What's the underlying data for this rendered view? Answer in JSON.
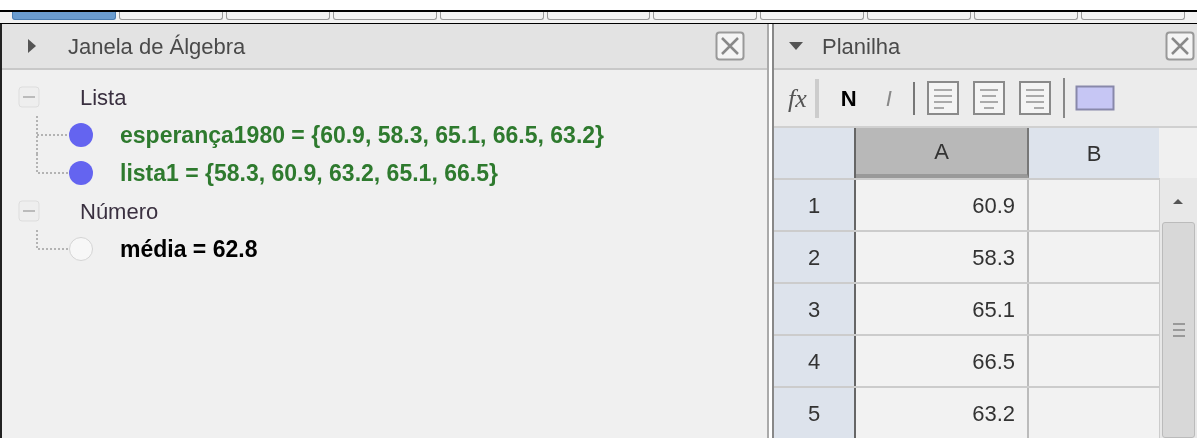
{
  "tabs": [
    {
      "selected": true
    },
    {
      "selected": false
    },
    {
      "selected": false
    },
    {
      "selected": false
    },
    {
      "selected": false
    },
    {
      "selected": false
    },
    {
      "selected": false
    },
    {
      "selected": false
    },
    {
      "selected": false
    },
    {
      "selected": false
    },
    {
      "selected": false
    }
  ],
  "algebra": {
    "title": "Janela de Álgebra",
    "expanded": false,
    "groups": [
      {
        "label": "Lista",
        "expanded": true,
        "children": [
          {
            "text": "esperança1980 = {60.9, 58.3, 65.1, 66.5, 63.2}",
            "visible": true,
            "color": "#2e7a2e"
          },
          {
            "text": "lista1 = {58.3, 60.9, 63.2, 65.1, 66.5}",
            "visible": true,
            "color": "#2e7a2e"
          }
        ]
      },
      {
        "label": "Número",
        "expanded": true,
        "children": [
          {
            "text": "média = 62.8",
            "visible": false,
            "color": "#000000"
          }
        ]
      }
    ]
  },
  "spreadsheet": {
    "title": "Planilha",
    "expanded": true,
    "toolbar": {
      "fx": "fx",
      "bold": "N",
      "italic": "I"
    },
    "columns": [
      {
        "label": "A",
        "selected": true
      },
      {
        "label": "B",
        "selected": false
      }
    ],
    "rows": [
      {
        "label": "1",
        "cells": [
          "60.9"
        ]
      },
      {
        "label": "2",
        "cells": [
          "58.3"
        ]
      },
      {
        "label": "3",
        "cells": [
          "65.1"
        ]
      },
      {
        "label": "4",
        "cells": [
          "66.5"
        ]
      },
      {
        "label": "5",
        "cells": [
          "63.2"
        ]
      }
    ]
  }
}
